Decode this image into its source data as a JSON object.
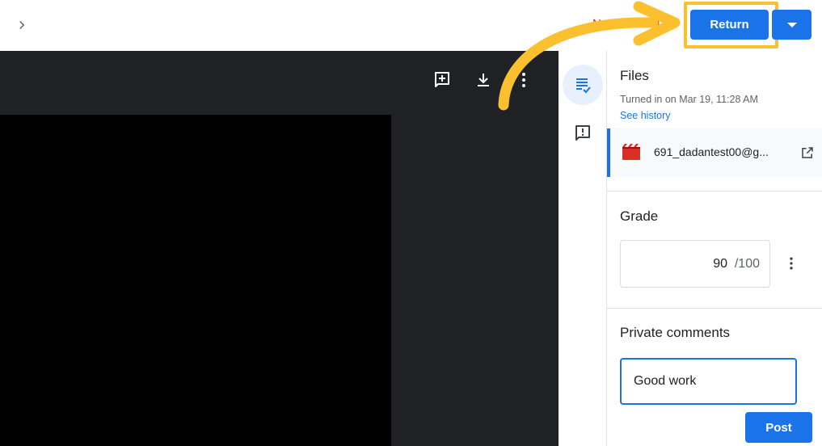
{
  "header": {
    "status_text": "Not returned",
    "return_label": "Return"
  },
  "files": {
    "title": "Files",
    "turned_in": "Turned in on Mar 19, 11:28 AM",
    "see_history": "See history",
    "file_name": "691_dadantest00@g..."
  },
  "grade": {
    "title": "Grade",
    "value": "90",
    "total": "/100"
  },
  "comments": {
    "title": "Private comments",
    "input_value": "Good work",
    "post_label": "Post"
  },
  "icons": {
    "expand": "chevron-right-icon",
    "return_menu": "arrow-drop-down-icon",
    "add_comment": "add-comment-icon",
    "download": "download-icon",
    "more": "more-vert-icon",
    "files_tab": "assignment-icon",
    "comments_tab": "comment-icon",
    "file_type": "video-file-icon",
    "open_external": "open-in-new-icon"
  },
  "colors": {
    "accent": "#1a73e8",
    "status": "#d93025",
    "highlight": "#fbc02d",
    "viewer_bg": "#202124"
  }
}
